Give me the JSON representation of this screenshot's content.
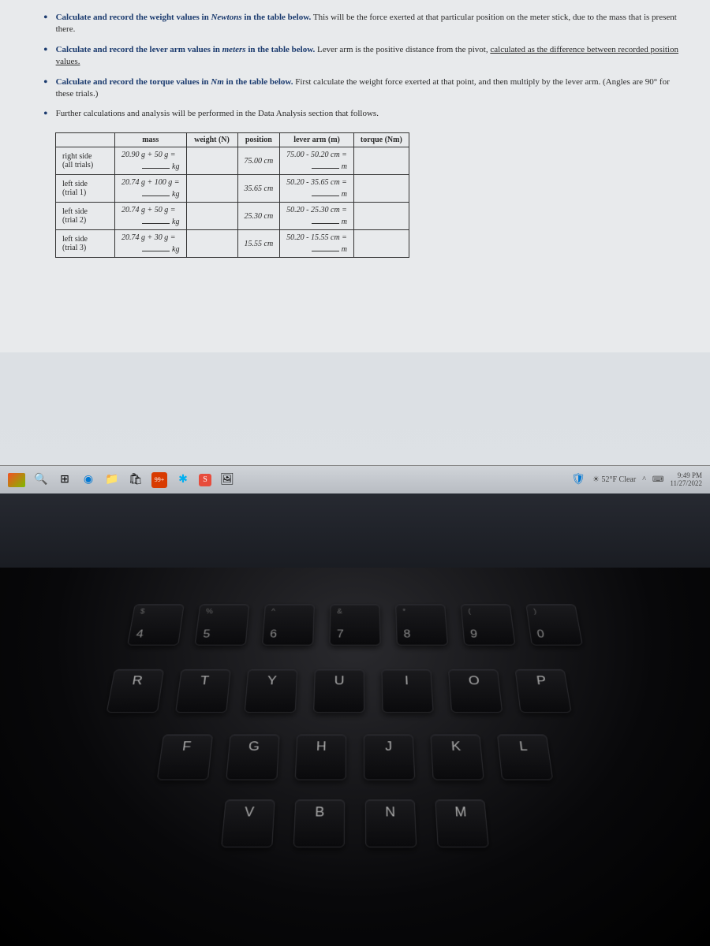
{
  "bullets": [
    {
      "bold": "Calculate and record the weight values in ",
      "italic": "Newtons",
      "bold2": " in the table below.",
      "rest": " This will be the force exerted at that particular position on the meter stick, due to the mass that is present there."
    },
    {
      "bold": "Calculate and record the lever arm values in ",
      "italic": "meters",
      "bold2": " in the table below.",
      "rest": " Lever arm is the positive distance from the pivot, ",
      "underline": "calculated as the difference between recorded position values."
    },
    {
      "bold": "Calculate and record the torque values in ",
      "italic": "Nm",
      "bold2": " in the table below.",
      "rest": " First calculate the weight force exerted at that point, and then multiply by the lever arm. (Angles are 90° for these trials.)"
    },
    {
      "rest": "Further calculations and analysis will be performed in the Data Analysis section that follows."
    }
  ],
  "table": {
    "headers": [
      "",
      "mass",
      "weight (N)",
      "position",
      "lever arm (m)",
      "torque (Nm)"
    ],
    "rows": [
      {
        "label": "right side\n(all trials)",
        "mass_eq": "20.90 g + 50 g =",
        "kg": "kg",
        "pos": "75.00 cm",
        "lever_eq": "75.00 - 50.20 cm =",
        "m": "m"
      },
      {
        "label": "left side\n(trial 1)",
        "mass_eq": "20.74 g + 100 g =",
        "kg": "kg",
        "pos": "35.65 cm",
        "lever_eq": "50.20 - 35.65 cm =",
        "m": "m"
      },
      {
        "label": "left side\n(trial 2)",
        "mass_eq": "20.74 g + 50 g =",
        "kg": "kg",
        "pos": "25.30 cm",
        "lever_eq": "50.20 - 25.30 cm =",
        "m": "m"
      },
      {
        "label": "left side\n(trial 3)",
        "mass_eq": "20.74 g + 30 g =",
        "kg": "kg",
        "pos": "15.55 cm",
        "lever_eq": "50.20 - 15.55 cm =",
        "m": "m"
      }
    ]
  },
  "taskbar": {
    "weather": "52°F Clear",
    "time": "9:49 PM",
    "date": "11/27/2022"
  },
  "keyboard": {
    "row0": [
      {
        "t": "$",
        "m": "4"
      },
      {
        "t": "%",
        "m": "5"
      },
      {
        "t": "^",
        "m": "6"
      },
      {
        "t": "&",
        "m": "7"
      },
      {
        "t": "*",
        "m": "8"
      },
      {
        "t": "(",
        "m": "9"
      },
      {
        "t": ")",
        "m": "0"
      }
    ],
    "row1": [
      "R",
      "T",
      "Y",
      "U",
      "I",
      "O",
      "P"
    ],
    "row2": [
      "F",
      "G",
      "H",
      "J",
      "K",
      "L"
    ],
    "row3": [
      "V",
      "B",
      "N",
      "M"
    ]
  }
}
